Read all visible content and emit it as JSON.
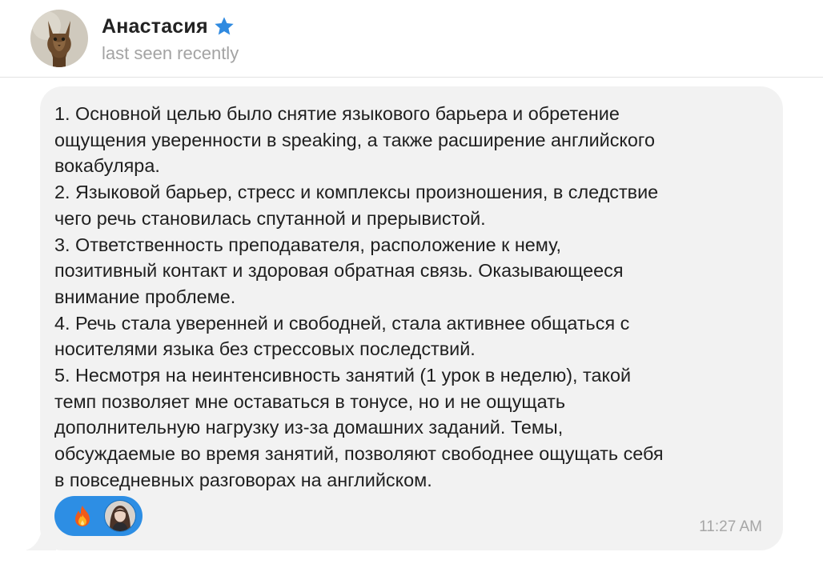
{
  "header": {
    "contact_name": "Анастасия",
    "status": "last seen recently",
    "verified_icon": "star-icon",
    "avatar_icon": "cat-avatar"
  },
  "message": {
    "text": "1. Основной целью было снятие языкового барьера и обретение\nощущения уверенности в speaking, а также расширение английского\nвокабуляра.\n2. Языковой барьер, стресс и комплексы произношения, в следствие\nчего речь становилась спутанной и прерывистой.\n3. Ответственность преподавателя, расположение к нему,\nпозитивный контакт и здоровая обратная связь. Оказывающееся\nвнимание проблеме.\n4. Речь стала уверенней и свободней, стала активнее общаться с\nносителями языка без стрессовых последствий.\n5. Несмотря на неинтенсивность занятий (1 урок в неделю), такой\nтемп позволяет мне оставаться в тонусе, но и не ощущать\nдополнительную нагрузку из-за домашних заданий. Темы,\nобсуждаемые во время занятий, позволяют свободнее ощущать себя\nв повседневных разговорах на английском.",
    "time": "11:27 AM",
    "reaction": {
      "emoji": "🔥",
      "reactor_icon": "user-avatar"
    }
  },
  "colors": {
    "bubble": "#f2f2f2",
    "reaction_pill": "#2d8ee4",
    "star": "#2f8ae0",
    "status_text": "#a3a3a3"
  }
}
